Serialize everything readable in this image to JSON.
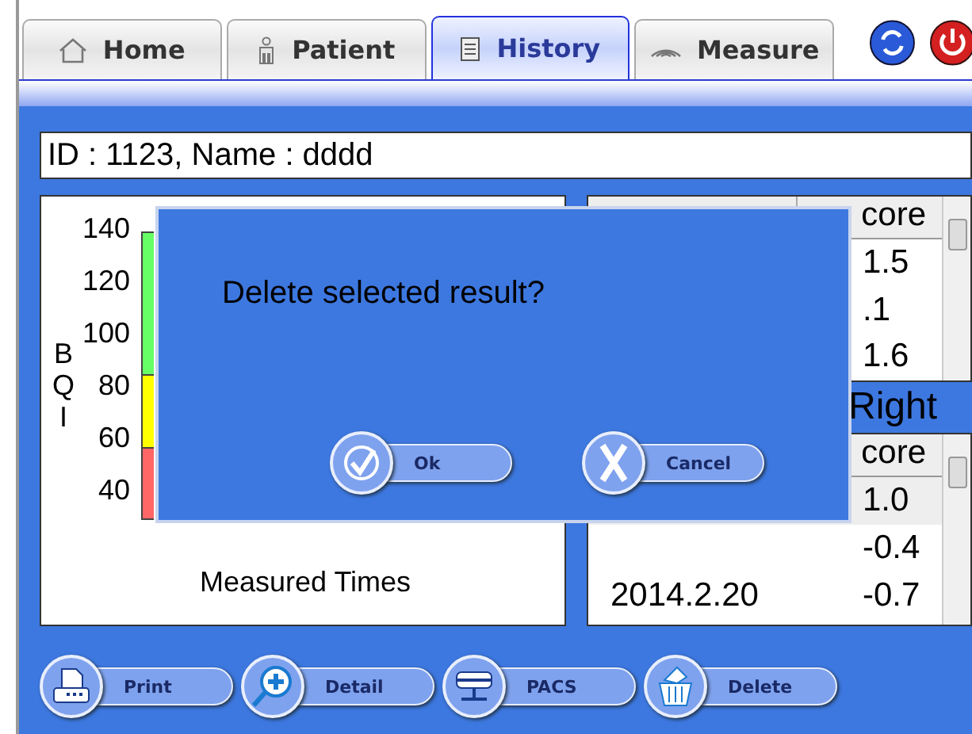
{
  "tabs": [
    {
      "label": "Home",
      "kind": "home",
      "selected": false
    },
    {
      "label": "Patient",
      "kind": "patient",
      "selected": false
    },
    {
      "label": "History",
      "kind": "history",
      "selected": true
    },
    {
      "label": "Measure",
      "kind": "measure",
      "selected": false
    }
  ],
  "patient_info": "ID : 1123, Name : dddd",
  "chart": {
    "ylabel": "BQI",
    "yticks": [
      "140",
      "120",
      "100",
      "80",
      "60",
      "40"
    ],
    "xlabel": "Measured Times"
  },
  "table_1": {
    "score_header": "core",
    "rows": [
      {
        "score": "1.5"
      },
      {
        "score": ".1"
      },
      {
        "score": "1.6"
      }
    ]
  },
  "right_table": {
    "title": "Right",
    "score_header": "core",
    "rows": [
      {
        "score": "1.0",
        "selected": true
      },
      {
        "score": "-0.4",
        "selected": false
      },
      {
        "date": "2014.2.20",
        "score": "-0.7",
        "selected": false
      }
    ]
  },
  "dialog": {
    "message": "Delete selected result?",
    "buttons": [
      {
        "label": "Ok",
        "kind": "ok"
      },
      {
        "label": "Cancel",
        "kind": "cancel"
      }
    ]
  },
  "actions": [
    {
      "label": "Print",
      "kind": "print"
    },
    {
      "label": "Detail",
      "kind": "detail"
    },
    {
      "label": "PACS",
      "kind": "pacs"
    },
    {
      "label": "Delete",
      "kind": "delete"
    }
  ]
}
